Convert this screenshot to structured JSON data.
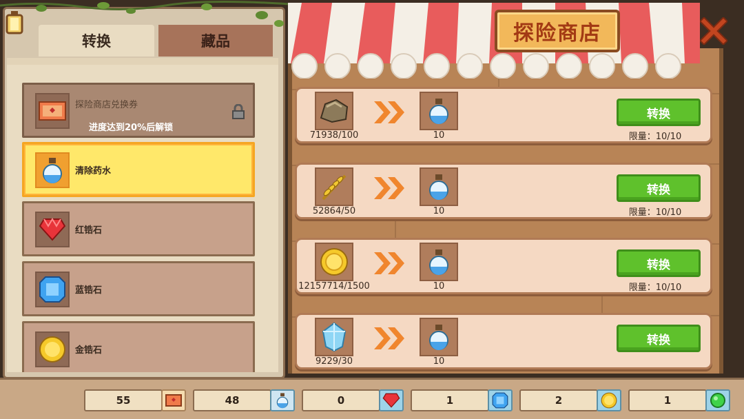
{
  "tabs": {
    "convert": "转换",
    "collection": "藏品"
  },
  "shop_title": "探险商店",
  "items": [
    {
      "name": "探险商店兑换券",
      "lock_text": "进度达到20%后解锁",
      "icon": "ticket-icon",
      "locked": true
    },
    {
      "name": "清除药水",
      "icon": "potion-icon",
      "selected": true
    },
    {
      "name": "红锆石",
      "icon": "red-gem-icon"
    },
    {
      "name": "蓝锆石",
      "icon": "blue-gem-icon"
    },
    {
      "name": "金锆石",
      "icon": "gold-gem-icon"
    }
  ],
  "trades": [
    {
      "source_icon": "rock-icon",
      "source_qty": "71938/100",
      "target_icon": "potion-icon",
      "target_qty": "10",
      "button": "转换",
      "limit": "限量：10/10"
    },
    {
      "source_icon": "wheat-icon",
      "source_qty": "52864/50",
      "target_icon": "potion-icon",
      "target_qty": "10",
      "button": "转换",
      "limit": "限量：10/10"
    },
    {
      "source_icon": "gold-coin-icon",
      "source_qty": "12157714/1500",
      "target_icon": "potion-icon",
      "target_qty": "10",
      "button": "转换",
      "limit": "限量：10/10"
    },
    {
      "source_icon": "diamond-icon",
      "source_qty": "9229/30",
      "target_icon": "potion-icon",
      "target_qty": "10",
      "button": "转换",
      "limit": ""
    }
  ],
  "resources": [
    {
      "value": "55",
      "icon": "ticket-icon"
    },
    {
      "value": "48",
      "icon": "potion-icon"
    },
    {
      "value": "0",
      "icon": "red-gem-icon"
    },
    {
      "value": "1",
      "icon": "blue-gem-icon"
    },
    {
      "value": "2",
      "icon": "gold-coin-icon"
    },
    {
      "value": "1",
      "icon": "green-orb-icon"
    }
  ],
  "colors": {
    "button_green": "#5fc12c",
    "selected_yellow": "#ffe86a",
    "awning_red": "#e85c5c"
  }
}
